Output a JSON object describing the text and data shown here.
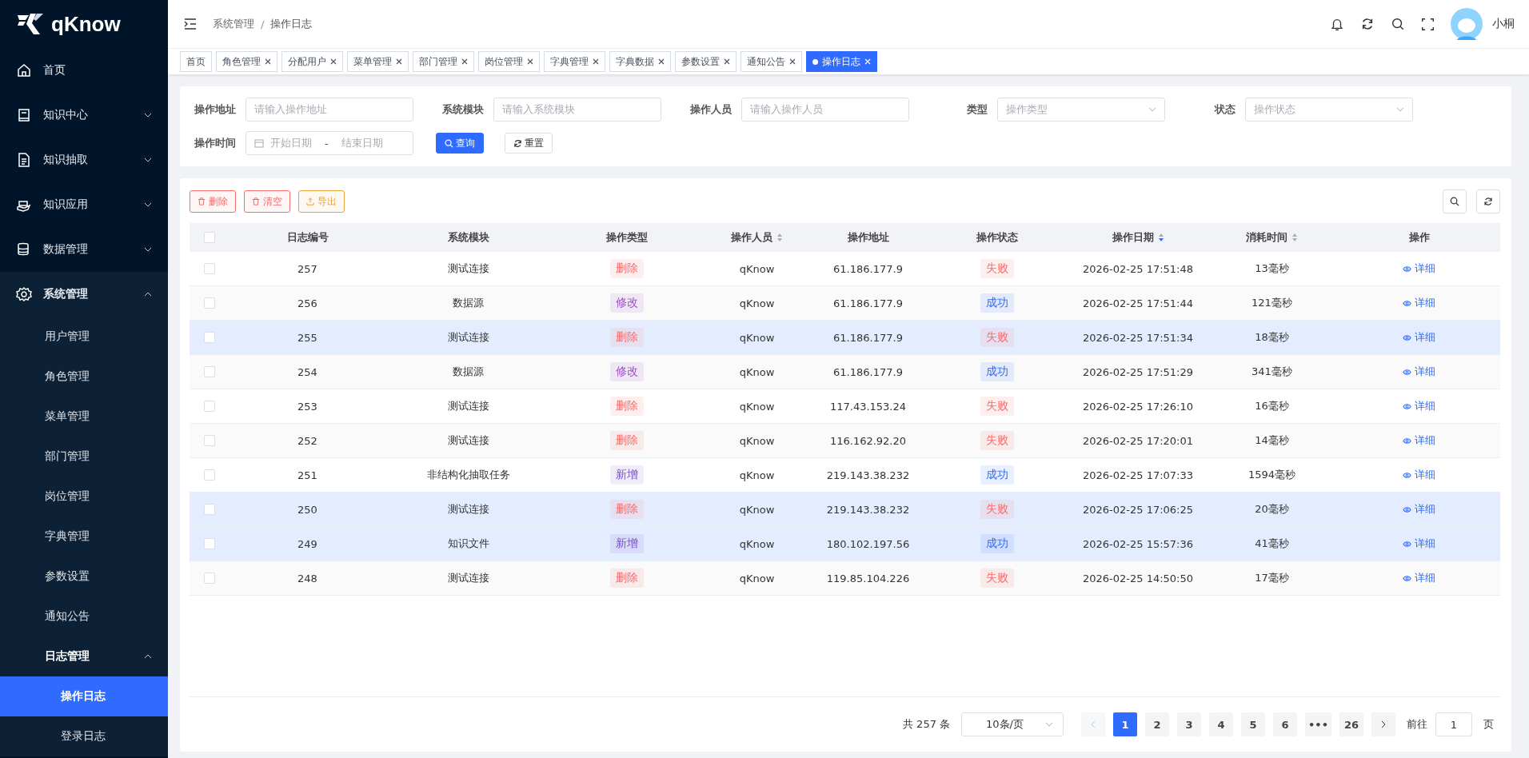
{
  "logo": {
    "text": "qKnow"
  },
  "sidebar": {
    "items": [
      {
        "label": "首页",
        "selected": false
      },
      {
        "label": "知识中心",
        "selected": false,
        "expanded": false
      },
      {
        "label": "知识抽取",
        "selected": false,
        "expanded": false
      },
      {
        "label": "知识应用",
        "selected": false,
        "expanded": false
      },
      {
        "label": "数据管理",
        "selected": false,
        "expanded": false
      },
      {
        "label": "系统管理",
        "selected": false,
        "expanded": true,
        "children": [
          {
            "label": "用户管理",
            "selected": false
          },
          {
            "label": "角色管理",
            "selected": false
          },
          {
            "label": "菜单管理",
            "selected": false
          },
          {
            "label": "部门管理",
            "selected": false
          },
          {
            "label": "岗位管理",
            "selected": false
          },
          {
            "label": "字典管理",
            "selected": false
          },
          {
            "label": "参数设置",
            "selected": false
          },
          {
            "label": "通知公告",
            "selected": false
          },
          {
            "label": "日志管理",
            "selected": false,
            "expanded": true,
            "children": [
              {
                "label": "操作日志",
                "selected": true
              },
              {
                "label": "登录日志",
                "selected": false
              }
            ]
          }
        ]
      }
    ]
  },
  "header": {
    "breadcrumb": [
      "系统管理",
      "操作日志"
    ],
    "breadcrumb_separator": "/",
    "user": {
      "name": "小桐"
    }
  },
  "tabs": [
    {
      "label": "首页",
      "selected": false,
      "closable": false
    },
    {
      "label": "角色管理",
      "selected": false,
      "closable": true
    },
    {
      "label": "分配用户",
      "selected": false,
      "closable": true
    },
    {
      "label": "菜单管理",
      "selected": false,
      "closable": true
    },
    {
      "label": "部门管理",
      "selected": false,
      "closable": true
    },
    {
      "label": "岗位管理",
      "selected": false,
      "closable": true
    },
    {
      "label": "字典管理",
      "selected": false,
      "closable": true
    },
    {
      "label": "字典数据",
      "selected": false,
      "closable": true
    },
    {
      "label": "参数设置",
      "selected": false,
      "closable": true
    },
    {
      "label": "通知公告",
      "selected": false,
      "closable": true
    },
    {
      "label": "操作日志",
      "selected": true,
      "closable": true
    }
  ],
  "filters": [
    {
      "label": "操作地址",
      "kind": "input",
      "placeholder": "请输入操作地址"
    },
    {
      "label": "系统模块",
      "kind": "input",
      "placeholder": "请输入系统模块"
    },
    {
      "label": "操作人员",
      "kind": "input",
      "placeholder": "请输入操作人员"
    },
    {
      "label": "类型",
      "kind": "select",
      "placeholder": "操作类型"
    },
    {
      "label": "状态",
      "kind": "select",
      "placeholder": "操作状态"
    },
    {
      "label": "操作时间",
      "kind": "daterange",
      "start_placeholder": "开始日期",
      "separator": "-",
      "end_placeholder": "结束日期"
    }
  ],
  "filter_buttons": [
    {
      "label": "查询",
      "kind": "primary"
    },
    {
      "label": "重置",
      "kind": "default"
    }
  ],
  "toolbar": [
    {
      "label": "删除",
      "kind": "delete",
      "color": "#f56c6c"
    },
    {
      "label": "清空",
      "kind": "delete",
      "color": "#f56c6c"
    },
    {
      "label": "导出",
      "kind": "export",
      "color": "#e6a23c"
    }
  ],
  "table": {
    "all_checked": false,
    "columns": [
      {
        "label": "日志编号"
      },
      {
        "label": "系统模块"
      },
      {
        "label": "操作类型"
      },
      {
        "label": "操作人员",
        "sort_desc": false
      },
      {
        "label": "操作地址"
      },
      {
        "label": "操作状态"
      },
      {
        "label": "操作日期",
        "sort_desc": true
      },
      {
        "label": "消耗时间",
        "sort_desc": false
      },
      {
        "label": "操作"
      }
    ],
    "rows": [
      {
        "checked": false,
        "highlighted": false,
        "id": "257",
        "module": "测试连接",
        "type": {
          "text": "删除",
          "color": "#f56c6c"
        },
        "user": "qKnow",
        "ip": "61.186.177.9",
        "status": {
          "text": "失败",
          "color": "#f56c6c"
        },
        "date": "2026-02-25 17:51:48",
        "cost": "13毫秒",
        "action": "详细"
      },
      {
        "checked": false,
        "highlighted": false,
        "id": "256",
        "module": "数据源",
        "type": {
          "text": "修改",
          "color": "#9c4fc4"
        },
        "user": "qKnow",
        "ip": "61.186.177.9",
        "status": {
          "text": "成功",
          "color": "#2f6bff"
        },
        "date": "2026-02-25 17:51:44",
        "cost": "121毫秒",
        "action": "详细"
      },
      {
        "checked": false,
        "highlighted": true,
        "id": "255",
        "module": "测试连接",
        "type": {
          "text": "删除",
          "color": "#f56c6c"
        },
        "user": "qKnow",
        "ip": "61.186.177.9",
        "status": {
          "text": "失败",
          "color": "#f56c6c"
        },
        "date": "2026-02-25 17:51:34",
        "cost": "18毫秒",
        "action": "详细"
      },
      {
        "checked": false,
        "highlighted": false,
        "id": "254",
        "module": "数据源",
        "type": {
          "text": "修改",
          "color": "#9c4fc4"
        },
        "user": "qKnow",
        "ip": "61.186.177.9",
        "status": {
          "text": "成功",
          "color": "#2f6bff"
        },
        "date": "2026-02-25 17:51:29",
        "cost": "341毫秒",
        "action": "详细"
      },
      {
        "checked": false,
        "highlighted": false,
        "id": "253",
        "module": "测试连接",
        "type": {
          "text": "删除",
          "color": "#f56c6c"
        },
        "user": "qKnow",
        "ip": "117.43.153.24",
        "status": {
          "text": "失败",
          "color": "#f56c6c"
        },
        "date": "2026-02-25 17:26:10",
        "cost": "16毫秒",
        "action": "详细"
      },
      {
        "checked": false,
        "highlighted": false,
        "id": "252",
        "module": "测试连接",
        "type": {
          "text": "删除",
          "color": "#f56c6c"
        },
        "user": "qKnow",
        "ip": "116.162.92.20",
        "status": {
          "text": "失败",
          "color": "#f56c6c"
        },
        "date": "2026-02-25 17:20:01",
        "cost": "14毫秒",
        "action": "详细"
      },
      {
        "checked": false,
        "highlighted": false,
        "id": "251",
        "module": "非结构化抽取任务",
        "type": {
          "text": "新增",
          "color": "#7552c9"
        },
        "user": "qKnow",
        "ip": "219.143.38.232",
        "status": {
          "text": "成功",
          "color": "#2f6bff"
        },
        "date": "2026-02-25 17:07:33",
        "cost": "1594毫秒",
        "action": "详细"
      },
      {
        "checked": false,
        "highlighted": true,
        "id": "250",
        "module": "测试连接",
        "type": {
          "text": "删除",
          "color": "#f56c6c"
        },
        "user": "qKnow",
        "ip": "219.143.38.232",
        "status": {
          "text": "失败",
          "color": "#f56c6c"
        },
        "date": "2026-02-25 17:06:25",
        "cost": "20毫秒",
        "action": "详细"
      },
      {
        "checked": false,
        "highlighted": true,
        "id": "249",
        "module": "知识文件",
        "type": {
          "text": "新增",
          "color": "#7552c9"
        },
        "user": "qKnow",
        "ip": "180.102.197.56",
        "status": {
          "text": "成功",
          "color": "#2f6bff"
        },
        "date": "2026-02-25 15:57:36",
        "cost": "41毫秒",
        "action": "详细"
      },
      {
        "checked": false,
        "highlighted": false,
        "id": "248",
        "module": "测试连接",
        "type": {
          "text": "删除",
          "color": "#f56c6c"
        },
        "user": "qKnow",
        "ip": "119.85.104.226",
        "status": {
          "text": "失败",
          "color": "#f56c6c"
        },
        "date": "2026-02-25 14:50:50",
        "cost": "17毫秒",
        "action": "详细"
      }
    ]
  },
  "pagination": {
    "total": "共 257 条",
    "page_size": "10条/页",
    "prev_disabled": true,
    "next_disabled": false,
    "pages": [
      {
        "label": "1",
        "selected": true
      },
      {
        "label": "2",
        "selected": false
      },
      {
        "label": "3",
        "selected": false
      },
      {
        "label": "4",
        "selected": false
      },
      {
        "label": "5",
        "selected": false
      },
      {
        "label": "6",
        "selected": false
      },
      {
        "label": "•••",
        "selected": false
      },
      {
        "label": "26",
        "selected": false
      }
    ],
    "goto_label": "前往",
    "goto_value": "1",
    "goto_suffix": "页"
  }
}
